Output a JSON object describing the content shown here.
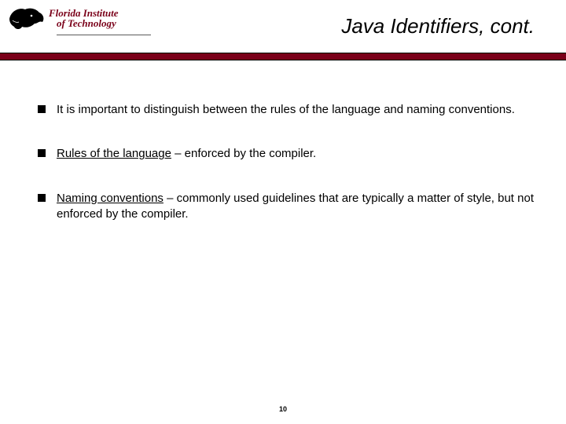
{
  "header": {
    "logo": {
      "line1": "Florida Institute",
      "line2": "of Technology"
    },
    "title": "Java Identifiers, cont."
  },
  "bullets": [
    {
      "prefix": "",
      "bold": "",
      "rest": "It is important to distinguish between the rules of the language and naming conventions."
    },
    {
      "prefix": "",
      "bold": "Rules of the language",
      "rest": " – enforced by the compiler."
    },
    {
      "prefix": "",
      "bold": "Naming conventions",
      "rest": " – commonly used guidelines that are typically a matter of style, but not enforced by the compiler."
    }
  ],
  "page_number": "10",
  "colors": {
    "brand": "#7a0019"
  }
}
